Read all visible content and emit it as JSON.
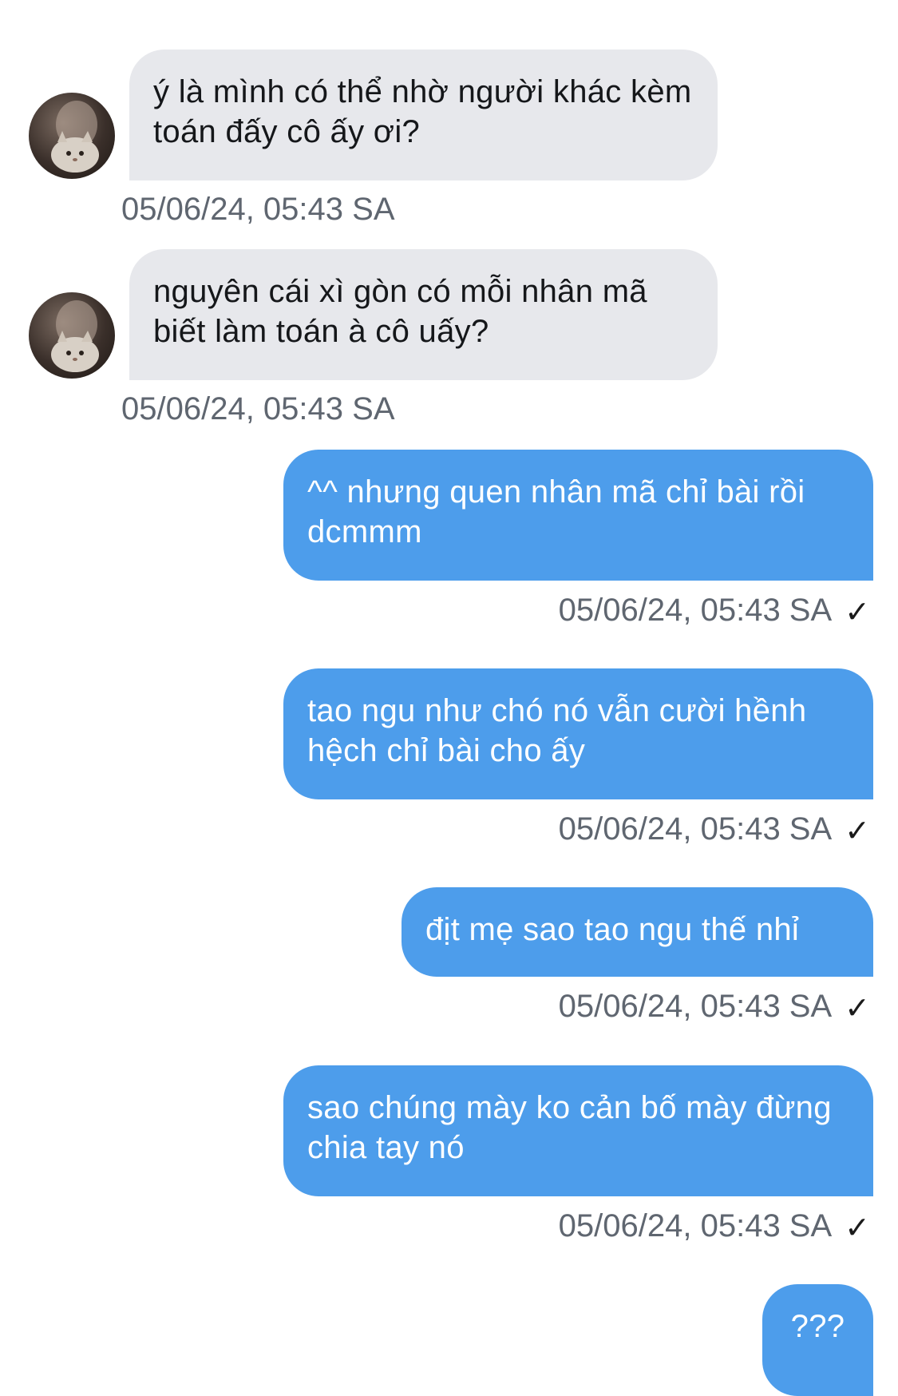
{
  "conversation": {
    "messages": [
      {
        "direction": "in",
        "text": "ý là mình có thể nhờ người khác kèm toán đấy cô ấy ơi?",
        "timestamp": "05/06/24, 05:43 SA"
      },
      {
        "direction": "in",
        "text": "nguyên cái xì gòn có mỗi nhân mã biết làm toán à cô uấy?",
        "timestamp": "05/06/24, 05:43 SA"
      },
      {
        "direction": "out",
        "text": "^^ nhưng quen nhân mã chỉ bài rồi dcmmm",
        "timestamp": "05/06/24, 05:43 SA",
        "status": "✓"
      },
      {
        "direction": "out",
        "text": "tao ngu như chó nó vẫn cười hềnh hệch chỉ bài cho ấy",
        "timestamp": "05/06/24, 05:43 SA",
        "status": "✓"
      },
      {
        "direction": "out",
        "text": "địt mẹ sao tao ngu thế nhỉ",
        "timestamp": "05/06/24, 05:43 SA",
        "status": "✓"
      },
      {
        "direction": "out",
        "text": "sao chúng mày ko cản bố mày đừng chia tay nó",
        "timestamp": "05/06/24, 05:43 SA",
        "status": "✓"
      },
      {
        "direction": "out",
        "text": "???"
      }
    ]
  },
  "colors": {
    "incoming_bubble": "#e7e8ec",
    "outgoing_bubble": "#4d9deb",
    "timestamp_text": "#5f6670"
  },
  "icons": {
    "avatar": "contact-avatar-cat-photo",
    "read_status": "checkmark-icon"
  }
}
